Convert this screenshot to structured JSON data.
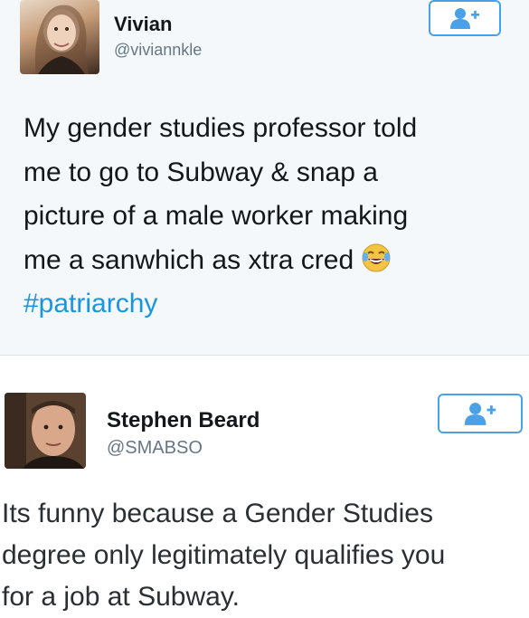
{
  "tweets": [
    {
      "name": "Vivian",
      "handle": "@viviannkle",
      "text_lines": [
        "My gender studies professor told",
        "me to go to Subway & snap a",
        "picture of a male worker making",
        "me a sanwhich as xtra cred"
      ],
      "hashtag": "#patriarchy",
      "emoji": "face-with-tears-of-joy",
      "follow_icon": "follow-icon"
    },
    {
      "name": "Stephen Beard",
      "handle": "@SMABSO",
      "text_lines": [
        "Its funny because a Gender Studies",
        "degree only legitimately qualifies you",
        "for a job at Subway."
      ],
      "follow_icon": "follow-icon"
    }
  ],
  "colors": {
    "link": "#1b95e0",
    "follow_border": "#4aa1e8",
    "handle": "#657786",
    "tweet1_background": "#f5f8fa"
  }
}
